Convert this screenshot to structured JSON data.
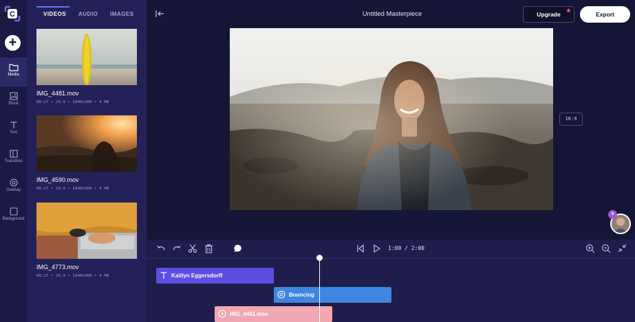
{
  "app": {
    "title": "Untitled Masterpiece",
    "logo_icon": "clipchamp-logo-icon"
  },
  "rail": {
    "add_icon": "plus-icon",
    "items": [
      {
        "label": "Media",
        "icon": "folder-icon",
        "active": true
      },
      {
        "label": "Stock",
        "icon": "image-icon",
        "active": false
      },
      {
        "label": "Text",
        "icon": "text-icon",
        "active": false
      },
      {
        "label": "Transition",
        "icon": "transition-icon",
        "active": false
      },
      {
        "label": "Overlay",
        "icon": "overlay-icon",
        "active": false
      },
      {
        "label": "Background",
        "icon": "background-icon",
        "active": false
      }
    ]
  },
  "panel": {
    "tabs": [
      {
        "label": "VIDEOS",
        "active": true
      },
      {
        "label": "AUDIO",
        "active": false
      },
      {
        "label": "IMAGES",
        "active": false
      }
    ],
    "media": [
      {
        "name": "IMG_4481.mov",
        "meta": "00:27 • 16:9 • 1440x900 • 4 MB"
      },
      {
        "name": "IMG_4590.mov",
        "meta": "00:27 • 16:9 • 1440x900 • 4 MB"
      },
      {
        "name": "IMG_4773.mov",
        "meta": "00:27 • 16:9 • 1440x900 • 4 MB"
      }
    ]
  },
  "header": {
    "upgrade_label": "Upgrade",
    "export_label": "Export"
  },
  "canvas": {
    "aspect_ratio": "16:9"
  },
  "collaborators": {
    "count_badge": "6"
  },
  "timeline": {
    "current_time": "1:00",
    "total_time": "2:00",
    "timecode": "1:00 / 2:00",
    "clips": [
      {
        "label": "Kaitlyn Eggersdorff",
        "type": "text",
        "color": "#5b4ee0",
        "icon": "text-icon"
      },
      {
        "label": "Bouncing",
        "type": "transition",
        "color": "#3f86e3",
        "icon": "transition-icon"
      },
      {
        "label": "IMG_4481.mov",
        "type": "video",
        "color": "#f0a7b1",
        "icon": "play-icon"
      }
    ]
  },
  "colors": {
    "background": "#151536",
    "panel": "#232157",
    "accent": "#5f79ff",
    "upgrade_star": "#ff5c93"
  }
}
